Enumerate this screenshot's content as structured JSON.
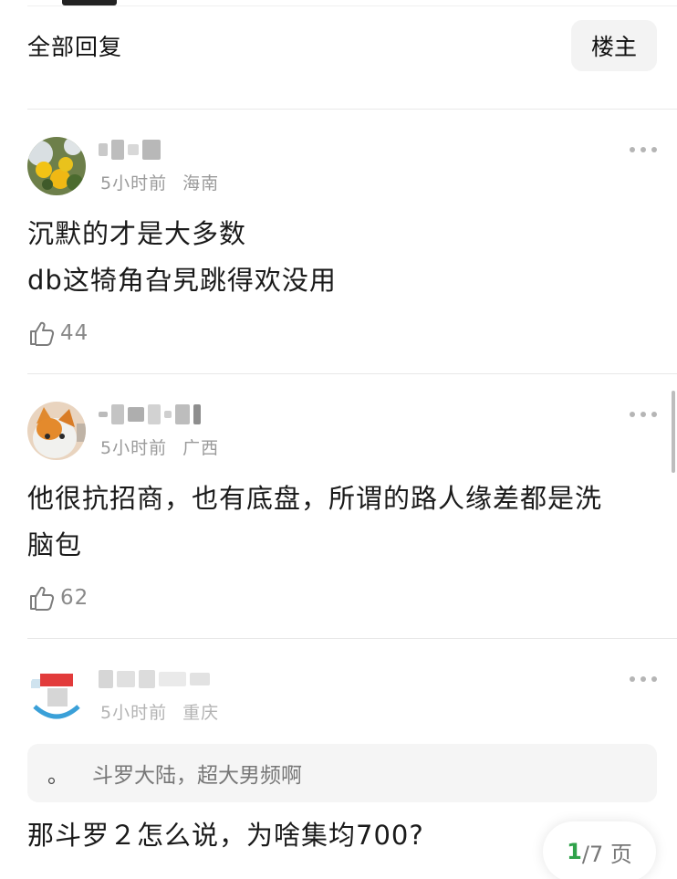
{
  "header": {
    "title": "全部回复",
    "op_filter_label": "楼主"
  },
  "comments": [
    {
      "time": "5小时前",
      "location": "海南",
      "lines": [
        "沉默的才是大多数",
        "db这犄角旮旯跳得欢没用"
      ],
      "likes": "44"
    },
    {
      "time": "5小时前",
      "location": "广西",
      "lines": [
        "他很抗招商，也有底盘，所谓的路人缘差都是洗",
        "脑包"
      ],
      "likes": "62"
    },
    {
      "time": "5小时前",
      "location": "重庆",
      "quote": "斗罗大陆，超大男频啊",
      "quote_marker": "。",
      "lines": [
        "那斗罗２怎么说，为啥集均700?"
      ]
    }
  ],
  "pagination": {
    "current": "1",
    "total": "/7 页"
  },
  "colors": {
    "accent_green": "#2fa24a",
    "meta_gray": "#9a9a9a",
    "divider": "#e8e8e8"
  }
}
